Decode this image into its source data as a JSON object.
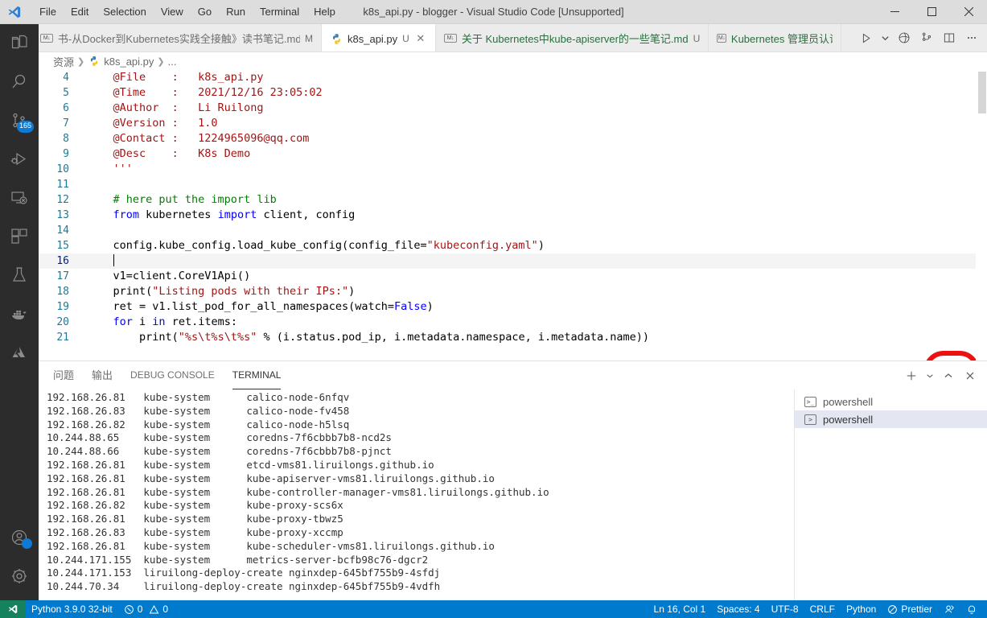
{
  "titlebar": {
    "title": "k8s_api.py - blogger - Visual Studio Code [Unsupported]",
    "menu": [
      "File",
      "Edit",
      "Selection",
      "View",
      "Go",
      "Run",
      "Terminal",
      "Help"
    ],
    "window_controls": [
      "minimize",
      "maximize",
      "close"
    ]
  },
  "activitybar": {
    "items": [
      {
        "icon": "explorer-icon",
        "name": "explorer",
        "badge": ""
      },
      {
        "icon": "search-icon",
        "name": "search",
        "badge": ""
      },
      {
        "icon": "source-control-icon",
        "name": "source-control",
        "badge": "165"
      },
      {
        "icon": "run-debug-icon",
        "name": "run-and-debug",
        "badge": ""
      },
      {
        "icon": "remote-explorer-icon",
        "name": "remote-explorer",
        "badge": ""
      },
      {
        "icon": "extensions-icon",
        "name": "extensions",
        "badge": ""
      },
      {
        "icon": "testing-icon",
        "name": "testing",
        "badge": ""
      },
      {
        "icon": "docker-icon",
        "name": "docker",
        "badge": ""
      },
      {
        "icon": "azure-icon",
        "name": "azure",
        "badge": ""
      }
    ],
    "bottom": [
      {
        "icon": "account-icon",
        "name": "accounts",
        "badge": "1"
      },
      {
        "icon": "gear-icon",
        "name": "manage-settings",
        "badge": ""
      }
    ]
  },
  "tabs": [
    {
      "label": "书-从Docker到Kubernetes实践全接触》读书笔记.md",
      "icon": "markdown-icon",
      "status": "M",
      "active": false,
      "closeable": false
    },
    {
      "label": "k8s_api.py",
      "icon": "python-icon",
      "status": "U",
      "active": true,
      "closeable": true
    },
    {
      "label": "关于 Kubernetes中kube-apiserver的一些笔记.md",
      "icon": "markdown-icon",
      "status": "U",
      "active": false,
      "closeable": false
    },
    {
      "label": "Kubernetes 管理员认证(CKA)考",
      "icon": "markdown-icon",
      "status": "",
      "active": false,
      "closeable": false
    }
  ],
  "tab_actions": [
    "run-python-file-icon",
    "chevron-down-icon",
    "preview-icon",
    "split-git-icon",
    "split-editor-icon",
    "more-actions-icon"
  ],
  "breadcrumb": {
    "root": "资源",
    "file": "k8s_api.py",
    "tail": "..."
  },
  "editor": {
    "lines": [
      {
        "no": "4",
        "segments": [
          {
            "t": "doc",
            "s": "    @File    :   k8s_api.py"
          }
        ]
      },
      {
        "no": "5",
        "segments": [
          {
            "t": "doc",
            "s": "    @Time    :   2021/12/16 23:05:02"
          }
        ]
      },
      {
        "no": "6",
        "segments": [
          {
            "t": "doc",
            "s": "    @Author  :   Li Ruilong"
          }
        ]
      },
      {
        "no": "7",
        "segments": [
          {
            "t": "doc",
            "s": "    @Version :   1.0"
          }
        ]
      },
      {
        "no": "8",
        "segments": [
          {
            "t": "doc",
            "s": "    @Contact :   1224965096@qq.com"
          }
        ]
      },
      {
        "no": "9",
        "segments": [
          {
            "t": "doc",
            "s": "    @Desc    :   K8s Demo"
          }
        ]
      },
      {
        "no": "10",
        "segments": [
          {
            "t": "doc",
            "s": "    '''"
          }
        ]
      },
      {
        "no": "11",
        "segments": [
          {
            "t": "pl",
            "s": ""
          }
        ]
      },
      {
        "no": "12",
        "segments": [
          {
            "t": "com",
            "s": "    # here put the import lib"
          }
        ]
      },
      {
        "no": "13",
        "segments": [
          {
            "t": "kw",
            "s": "    from"
          },
          {
            "t": "pl",
            "s": " kubernetes "
          },
          {
            "t": "kw",
            "s": "import"
          },
          {
            "t": "pl",
            "s": " client, config"
          }
        ]
      },
      {
        "no": "14",
        "segments": [
          {
            "t": "pl",
            "s": ""
          }
        ]
      },
      {
        "no": "15",
        "segments": [
          {
            "t": "pl",
            "s": "    config.kube_config.load_kube_config(config_file="
          },
          {
            "t": "str",
            "s": "\"kubeconfig.yaml\""
          },
          {
            "t": "pl",
            "s": ")"
          }
        ]
      },
      {
        "no": "16",
        "segments": [
          {
            "t": "pl",
            "s": "    "
          }
        ],
        "current": true,
        "cursor": true
      },
      {
        "no": "17",
        "segments": [
          {
            "t": "pl",
            "s": "    v1=client.CoreV1Api()"
          }
        ]
      },
      {
        "no": "18",
        "segments": [
          {
            "t": "pl",
            "s": "    print("
          },
          {
            "t": "str",
            "s": "\"Listing pods with their IPs:\""
          },
          {
            "t": "pl",
            "s": ")"
          }
        ]
      },
      {
        "no": "19",
        "segments": [
          {
            "t": "pl",
            "s": "    ret = v1.list_pod_for_all_namespaces(watch="
          },
          {
            "t": "kw",
            "s": "False"
          },
          {
            "t": "pl",
            "s": ")"
          }
        ]
      },
      {
        "no": "20",
        "segments": [
          {
            "t": "kw",
            "s": "    for"
          },
          {
            "t": "pl",
            "s": " i "
          },
          {
            "t": "kw",
            "s": "in"
          },
          {
            "t": "pl",
            "s": " ret.items:"
          }
        ]
      },
      {
        "no": "21",
        "segments": [
          {
            "t": "pl",
            "s": "        print("
          },
          {
            "t": "str",
            "s": "\"%s\\t%s\\t%s\""
          },
          {
            "t": "pl",
            "s": " % (i.status.pod_ip, i.metadata.namespace, i.metadata.name))"
          }
        ]
      }
    ],
    "watermark": "red-seal-stamp"
  },
  "panel": {
    "tabs": [
      {
        "label": "问题",
        "active": false,
        "cjk": true
      },
      {
        "label": "输出",
        "active": false,
        "cjk": true
      },
      {
        "label": "DEBUG CONSOLE",
        "active": false,
        "cjk": false
      },
      {
        "label": "TERMINAL",
        "active": true,
        "cjk": false
      }
    ],
    "actions": [
      "new-terminal-icon",
      "chevron-down-icon",
      "maximize-panel-icon",
      "close-panel-icon"
    ],
    "terminal_output": [
      "192.168.26.81   kube-system      calico-node-6nfqv",
      "192.168.26.83   kube-system      calico-node-fv458",
      "192.168.26.82   kube-system      calico-node-h5lsq",
      "10.244.88.65    kube-system      coredns-7f6cbbb7b8-ncd2s",
      "10.244.88.66    kube-system      coredns-7f6cbbb7b8-pjnct",
      "192.168.26.81   kube-system      etcd-vms81.liruilongs.github.io",
      "192.168.26.81   kube-system      kube-apiserver-vms81.liruilongs.github.io",
      "192.168.26.81   kube-system      kube-controller-manager-vms81.liruilongs.github.io",
      "192.168.26.82   kube-system      kube-proxy-scs6x",
      "192.168.26.81   kube-system      kube-proxy-tbwz5",
      "192.168.26.83   kube-system      kube-proxy-xccmp",
      "192.168.26.81   kube-system      kube-scheduler-vms81.liruilongs.github.io",
      "10.244.171.155  kube-system      metrics-server-bcfb98c76-dgcr2",
      "10.244.171.153  liruilong-deploy-create nginxdep-645bf755b9-4sfdj",
      "10.244.70.34    liruilong-deploy-create nginxdep-645bf755b9-4vdfh"
    ],
    "terminal_list": [
      {
        "label": "powershell",
        "selected": false
      },
      {
        "label": "powershell",
        "selected": true
      }
    ]
  },
  "statusbar": {
    "remote_icon": "remote-window-icon",
    "left": [
      {
        "name": "python-interpreter",
        "label": "Python 3.9.0 32-bit"
      },
      {
        "name": "problems",
        "label": "0",
        "label2": "0",
        "icons": [
          "error-icon",
          "warning-icon"
        ]
      }
    ],
    "right": [
      {
        "name": "cursor-position",
        "label": "Ln 16, Col 1"
      },
      {
        "name": "indentation",
        "label": "Spaces: 4"
      },
      {
        "name": "encoding",
        "label": "UTF-8"
      },
      {
        "name": "eol",
        "label": "CRLF"
      },
      {
        "name": "language-mode",
        "label": "Python"
      },
      {
        "name": "prettier",
        "label": "Prettier"
      },
      {
        "name": "live-share",
        "label": ""
      },
      {
        "name": "notifications",
        "label": ""
      }
    ]
  },
  "colors": {
    "accent": "#007acc",
    "remote": "#16825d",
    "activitybar_bg": "#2c2c2c",
    "titlebar_bg": "#dddddd",
    "badge": "#0e7ad4",
    "seal": "#ee1111"
  }
}
